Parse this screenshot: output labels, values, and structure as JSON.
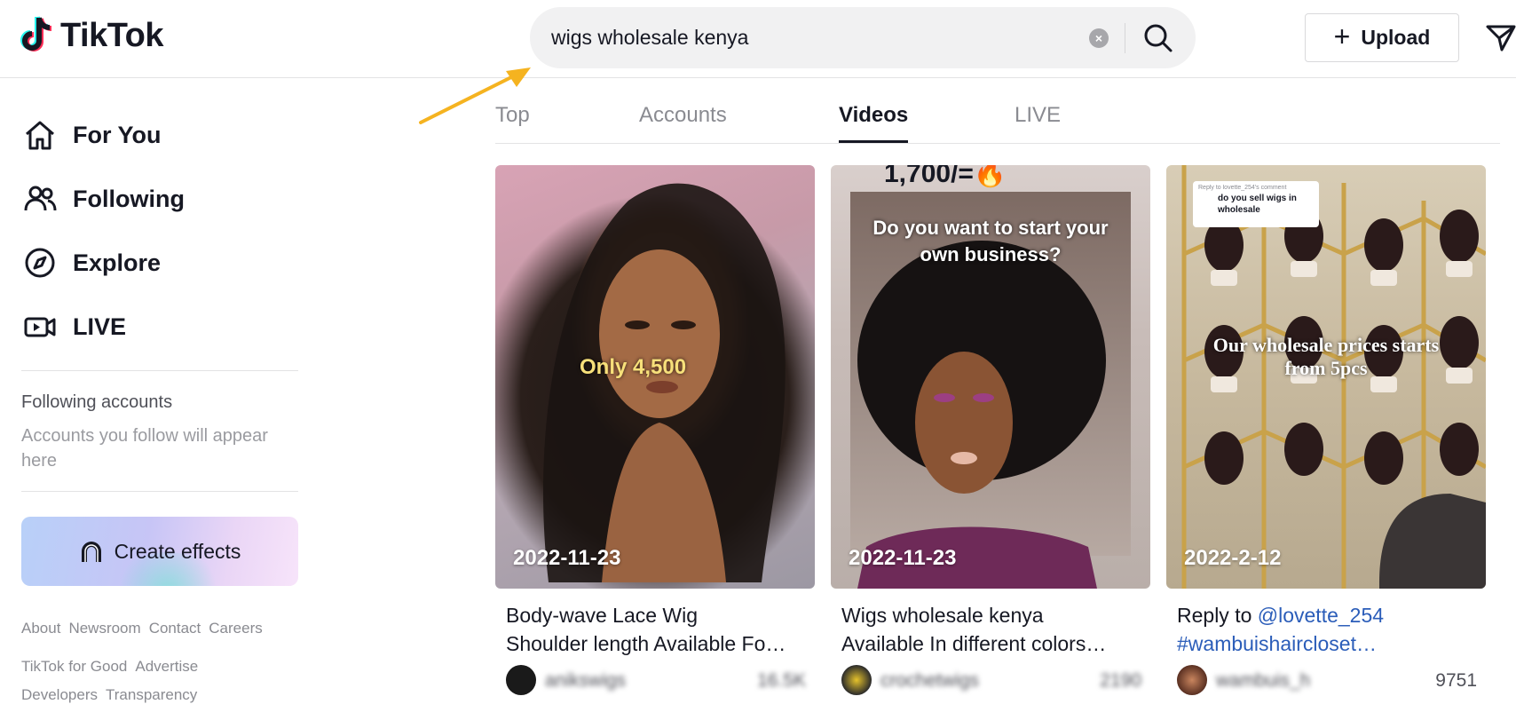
{
  "header": {
    "logo_text": "TikTok",
    "search_value": "wigs wholesale kenya",
    "upload_label": "Upload"
  },
  "sidebar": {
    "nav": [
      {
        "label": "For You",
        "icon": "home-icon"
      },
      {
        "label": "Following",
        "icon": "people-icon"
      },
      {
        "label": "Explore",
        "icon": "compass-icon"
      },
      {
        "label": "LIVE",
        "icon": "live-camera-icon"
      }
    ],
    "following_heading": "Following accounts",
    "following_note": "Accounts you follow will appear here",
    "create_effects_label": "Create effects",
    "footer_row1": [
      "About",
      "Newsroom",
      "Contact",
      "Careers"
    ],
    "footer_row2": [
      "TikTok for Good",
      "Advertise"
    ],
    "footer_row3": [
      "Developers",
      "Transparency"
    ]
  },
  "tabs": [
    {
      "label": "Top",
      "active": false
    },
    {
      "label": "Accounts",
      "active": false
    },
    {
      "label": "Videos",
      "active": true
    },
    {
      "label": "LIVE",
      "active": false
    }
  ],
  "videos": [
    {
      "date": "2022-11-23",
      "overlay": "Only 4,500",
      "description": "Body-wave Lace Wig Shoulder length Available Fo…",
      "desc_line1": "Body-wave Lace Wig",
      "desc_line2": "Shoulder length Available Fo…",
      "username": "anikswigs",
      "views": "16.5K"
    },
    {
      "date": "2022-11-23",
      "overlay_top": "1,700/=🔥",
      "overlay": "Do you want to start your own business?",
      "desc_line1": "Wigs wholesale kenya",
      "desc_line2": "Available In different colors…",
      "username": "crochetwigs",
      "views": "2190"
    },
    {
      "date": "2022-2-12",
      "overlay": "Our wholesale prices starts from 5pcs",
      "comment_header": "Reply to lovette_254's comment",
      "comment_text": "do you sell wigs in wholesale",
      "desc_line1_prefix": "Reply to ",
      "desc_line1_mention": "@lovette_254",
      "desc_line2": "#wambuishaircloset…",
      "username": "wambuis_h",
      "views": "9751"
    }
  ],
  "colors": {
    "accent_link": "#2b5db9",
    "arrow": "#f5b320",
    "text": "#161823"
  }
}
